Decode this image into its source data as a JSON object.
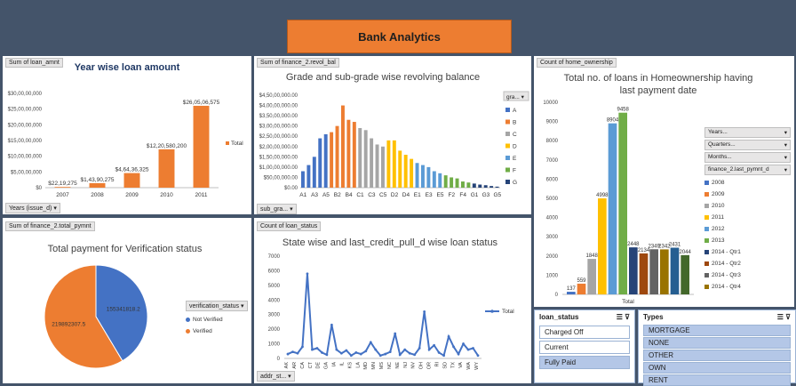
{
  "banner": {
    "title": "Bank Analytics"
  },
  "colors": {
    "orange": "#ed7d31",
    "blue": "#4472c4",
    "gray": "#a5a5a5",
    "yellow": "#ffc000",
    "lightblue": "#5b9bd5",
    "green": "#70ad47",
    "navy": "#264478",
    "darkorange": "#9e480e"
  },
  "panel1": {
    "field_button": "Sum of loan_amnt",
    "axis_button": "Years (issue_d)",
    "legend": "Total",
    "chart_data": {
      "type": "bar",
      "title": "Year wise loan amount",
      "categories": [
        "2007",
        "2008",
        "2009",
        "2010",
        "2011"
      ],
      "values": [
        22191275,
        143903275,
        464363325,
        1220580200,
        2605068575
      ],
      "data_labels": [
        "$22,19,275",
        "$1,43,90,275",
        "$4,64,36,325",
        "$12,20,580,200",
        "$26,05,06,575"
      ],
      "y_ticks": [
        "$0",
        "$5,00,00,000",
        "$10,00,00,000",
        "$15,00,00,000",
        "$20,00,00,000",
        "$25,00,00,000",
        "$30,00,00,000"
      ],
      "ylim": [
        0,
        3000000000
      ]
    }
  },
  "panel2": {
    "field_button": "Sum of finance_2.revol_bal",
    "axis_button": "sub_gra...",
    "legend_title": "gra...",
    "chart_data": {
      "type": "bar",
      "title": "Grade and sub-grade wise revolving balance",
      "categories": [
        "A1",
        "A2",
        "A3",
        "A4",
        "A5",
        "B1",
        "B2",
        "B3",
        "B4",
        "B5",
        "C1",
        "C2",
        "C3",
        "C4",
        "C5",
        "D1",
        "D2",
        "D3",
        "D4",
        "D5",
        "E1",
        "E2",
        "E3",
        "E4",
        "E5",
        "F1",
        "F2",
        "F3",
        "F4",
        "F5",
        "G1",
        "G2",
        "G3",
        "G4",
        "G5"
      ],
      "x_tick_labels": [
        "A1",
        "A3",
        "A5",
        "B2",
        "B4",
        "C1",
        "C3",
        "C5",
        "D2",
        "D4",
        "E1",
        "E3",
        "E5",
        "F2",
        "F4",
        "G1",
        "G3",
        "G5"
      ],
      "values": [
        80000000,
        110000000,
        150000000,
        240000000,
        260000000,
        270000000,
        300000000,
        400000000,
        330000000,
        320000000,
        290000000,
        280000000,
        240000000,
        210000000,
        200000000,
        230000000,
        230000000,
        180000000,
        160000000,
        140000000,
        120000000,
        110000000,
        100000000,
        80000000,
        70000000,
        60000000,
        50000000,
        45000000,
        30000000,
        25000000,
        20000000,
        15000000,
        12000000,
        8000000,
        5000000
      ],
      "series_groups": [
        "A",
        "B",
        "C",
        "D",
        "E",
        "F",
        "G"
      ],
      "y_ticks": [
        "$0.00",
        "$50,00,000.00",
        "$1,00,00,000.00",
        "$1,50,00,000.00",
        "$2,00,00,000.00",
        "$2,50,00,000.00",
        "$3,00,00,000.00",
        "$3,50,00,000.00",
        "$4,00,00,000.00",
        "$4,50,00,000.00"
      ],
      "ylim": [
        0,
        450000000
      ]
    }
  },
  "panel3": {
    "field_button": "Count of home_ownership",
    "x_label": "Total",
    "chart_data": {
      "type": "bar",
      "title": "Total no. of loans in Homeownership having last payment date",
      "series": [
        {
          "name": "2008",
          "value": 137
        },
        {
          "name": "2009",
          "value": 559
        },
        {
          "name": "2010",
          "value": 1848
        },
        {
          "name": "2011",
          "value": 4998
        },
        {
          "name": "2012",
          "value": 8904
        },
        {
          "name": "2013",
          "value": 9458
        },
        {
          "name": "2014 - Qtr1",
          "value": 2448
        },
        {
          "name": "2014 - Qtr2",
          "value": 2134
        },
        {
          "name": "2014 - Qtr3",
          "value": 2349
        },
        {
          "name": "2014 - Qtr4",
          "value": 2342
        },
        {
          "name": "",
          "value": 2431
        },
        {
          "name": "",
          "value": 2044
        }
      ],
      "y_ticks": [
        "0",
        "1000",
        "2000",
        "3000",
        "4000",
        "5000",
        "6000",
        "7000",
        "8000",
        "9000",
        "10000"
      ],
      "ylim": [
        0,
        10000
      ]
    },
    "filters": [
      "Years...",
      "Quarters...",
      "Months...",
      "finance_2.last_pymnt_d"
    ]
  },
  "panel4": {
    "field_button": "Sum of finance_2.total_pymnt",
    "legend_title": "verification_status",
    "chart_data": {
      "type": "pie",
      "title": "Total payment for Verification status",
      "slices": [
        {
          "name": "Not Verified",
          "value": 155341818.2,
          "label": "155341818.2"
        },
        {
          "name": "Verified",
          "value": 219892307.5,
          "label": "219892307.5"
        }
      ]
    }
  },
  "panel5": {
    "field_button": "Count of loan_status",
    "axis_button": "addr_st...",
    "legend": "Total",
    "chart_data": {
      "type": "line",
      "title": "State wise and last_credit_pull_d wise loan status",
      "x_tick_labels": [
        "AK",
        "AR",
        "CA",
        "CT",
        "DE",
        "GA",
        "IA",
        "IL",
        "KS",
        "LA",
        "MD",
        "MN",
        "MS",
        "NC",
        "NE",
        "NJ",
        "NV",
        "OH",
        "OR",
        "RI",
        "SD",
        "TX",
        "VA",
        "WA",
        "WY"
      ],
      "values": [
        300,
        450,
        350,
        800,
        5800,
        600,
        700,
        400,
        250,
        2300,
        600,
        350,
        550,
        200,
        400,
        300,
        500,
        1100,
        600,
        200,
        300,
        450,
        1700,
        250,
        600,
        350,
        250,
        700,
        3200,
        600,
        900,
        400,
        200,
        1500,
        800,
        300,
        1000,
        600,
        700,
        200
      ],
      "y_ticks": [
        "0",
        "1000",
        "2000",
        "3000",
        "4000",
        "5000",
        "6000",
        "7000"
      ],
      "ylim": [
        0,
        7000
      ]
    }
  },
  "slicer_loan": {
    "title": "loan_status",
    "items": [
      "Charged Off",
      "Current",
      "Fully Paid"
    ]
  },
  "slicer_types": {
    "title": "Types",
    "items": [
      "MORTGAGE",
      "NONE",
      "OTHER",
      "OWN",
      "RENT"
    ]
  }
}
